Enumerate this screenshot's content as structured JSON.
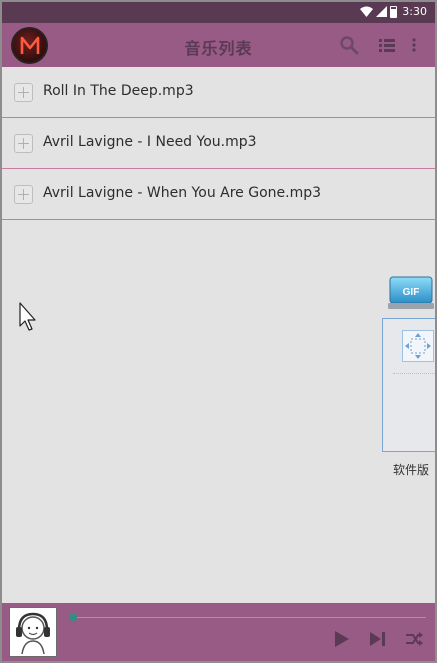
{
  "status_bar": {
    "time": "3:30"
  },
  "app_bar": {
    "title": "音乐列表",
    "logo_letter": "M",
    "icons": [
      "search-icon",
      "list-icon",
      "overflow-menu-icon"
    ]
  },
  "songs": [
    {
      "title": "Roll In The Deep.mp3"
    },
    {
      "title": "Avril Lavigne - I Need You.mp3"
    },
    {
      "title": "Avril Lavigne - When You Are Gone.mp3"
    }
  ],
  "overlay": {
    "gif_label": "GIF",
    "caption": "软件版"
  },
  "player": {
    "progress": 0,
    "controls": [
      "play-icon",
      "next-icon",
      "shuffle-icon"
    ]
  },
  "colors": {
    "status_bar": "#5a3a52",
    "app_bar": "#975b86",
    "title_text": "#5b3a55",
    "list_divider": "#ca7c9f",
    "background": "#e3e3e3",
    "progress_knob": "#2f8f84"
  }
}
